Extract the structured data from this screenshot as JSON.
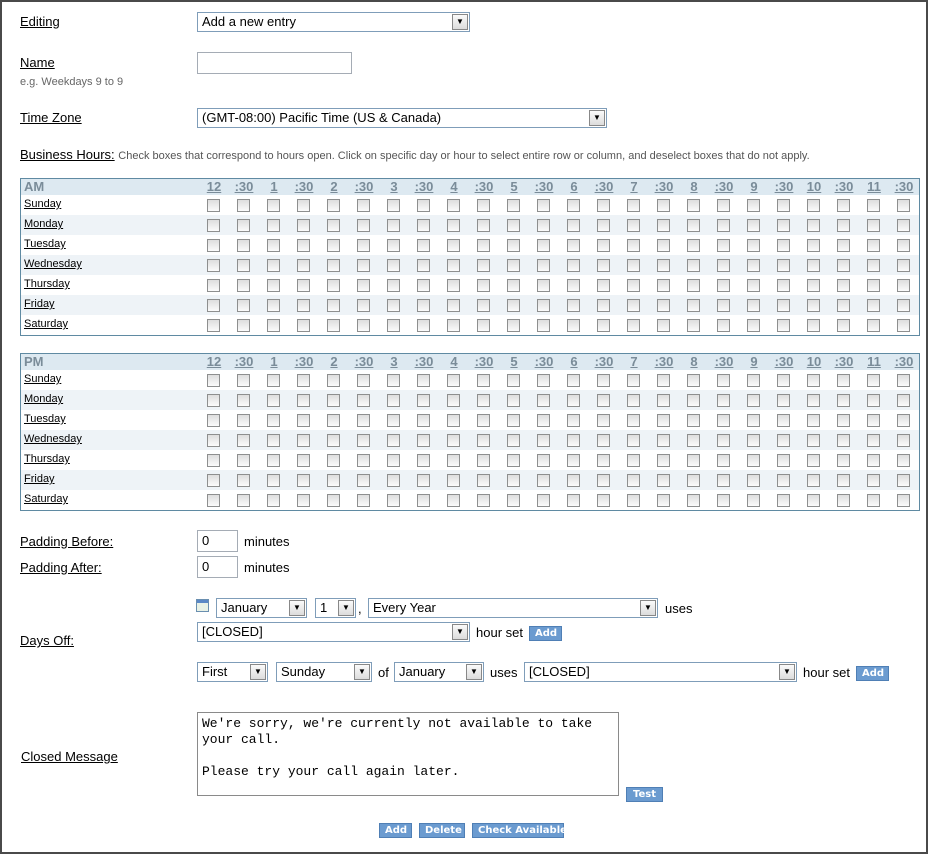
{
  "editing": {
    "label": "Editing",
    "value": "Add a new entry"
  },
  "name": {
    "label": "Name",
    "hint": "e.g. Weekdays 9 to 9",
    "value": ""
  },
  "time_zone": {
    "label": "Time Zone",
    "value": "(GMT-08:00) Pacific Time (US & Canada)"
  },
  "business_hours": {
    "label": "Business Hours:",
    "hint": "Check boxes that correspond to hours open. Click on specific day or hour to select entire row or column, and deselect boxes that do not apply.",
    "columns": [
      "12",
      ":30",
      "1",
      ":30",
      "2",
      ":30",
      "3",
      ":30",
      "4",
      ":30",
      "5",
      ":30",
      "6",
      ":30",
      "7",
      ":30",
      "8",
      ":30",
      "9",
      ":30",
      "10",
      ":30",
      "11",
      ":30"
    ],
    "days": [
      "Sunday",
      "Monday",
      "Tuesday",
      "Wednesday",
      "Thursday",
      "Friday",
      "Saturday"
    ],
    "am_label": "AM",
    "pm_label": "PM"
  },
  "padding_before": {
    "label": "Padding Before:",
    "value": "0",
    "unit": "minutes"
  },
  "padding_after": {
    "label": "Padding After:",
    "value": "0",
    "unit": "minutes"
  },
  "days_off": {
    "label": "Days Off:",
    "month": "January",
    "day": "1",
    "comma": ",",
    "recurrence": "Every Year",
    "uses": "uses",
    "hour_set_value": "[CLOSED]",
    "hour_set": "hour set",
    "add": "Add",
    "rule_ordinal": "First",
    "rule_weekday": "Sunday",
    "of": "of",
    "rule_month": "January",
    "rule_uses": "uses",
    "rule_hour_set_value": "[CLOSED]",
    "rule_hour_set": "hour set",
    "rule_add": "Add"
  },
  "closed_message": {
    "label": "Closed Message",
    "value": "We're sorry, we're currently not available to take\nyour call.\n\nPlease try your call again later.",
    "test": "Test"
  },
  "footer": {
    "add": "Add",
    "delete": "Delete",
    "check_available": "Check Available"
  }
}
